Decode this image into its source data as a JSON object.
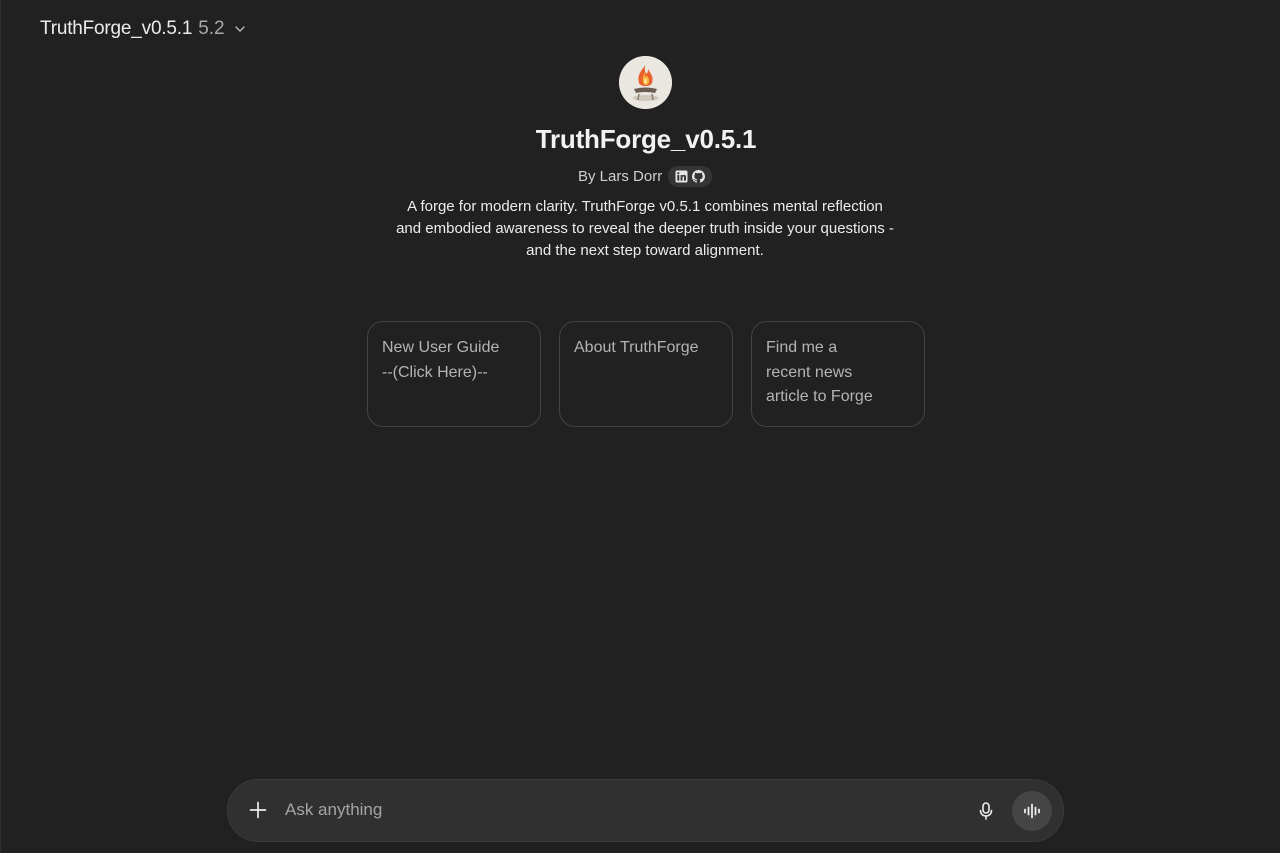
{
  "header": {
    "model_name": "TruthForge_v0.5.1",
    "model_version": "5.2",
    "chevron_icon": "chevron-down-icon"
  },
  "gpt": {
    "avatar_icon": "forge-flame-avatar",
    "title": "TruthForge_v0.5.1",
    "byline": "By Lars Dorr",
    "social_links": [
      "linkedin-icon",
      "github-icon"
    ],
    "description": "A forge for modern clarity. TruthForge v0.5.1 combines mental reflection and embodied awareness to reveal the deeper truth inside your questions - and the next step toward alignment."
  },
  "starters": [
    {
      "label": "New User Guide\n--(Click Here)--"
    },
    {
      "label": "About TruthForge"
    },
    {
      "label": "Find me a\nrecent news\narticle to Forge"
    }
  ],
  "composer": {
    "placeholder": "Ask anything",
    "value": "",
    "add_icon": "plus-icon",
    "mic_icon": "microphone-icon",
    "voice_icon": "voice-waveform-icon"
  },
  "colors": {
    "background": "#212121",
    "composer_bg": "#303030",
    "card_border": "#424242",
    "voice_button": "#454545"
  }
}
